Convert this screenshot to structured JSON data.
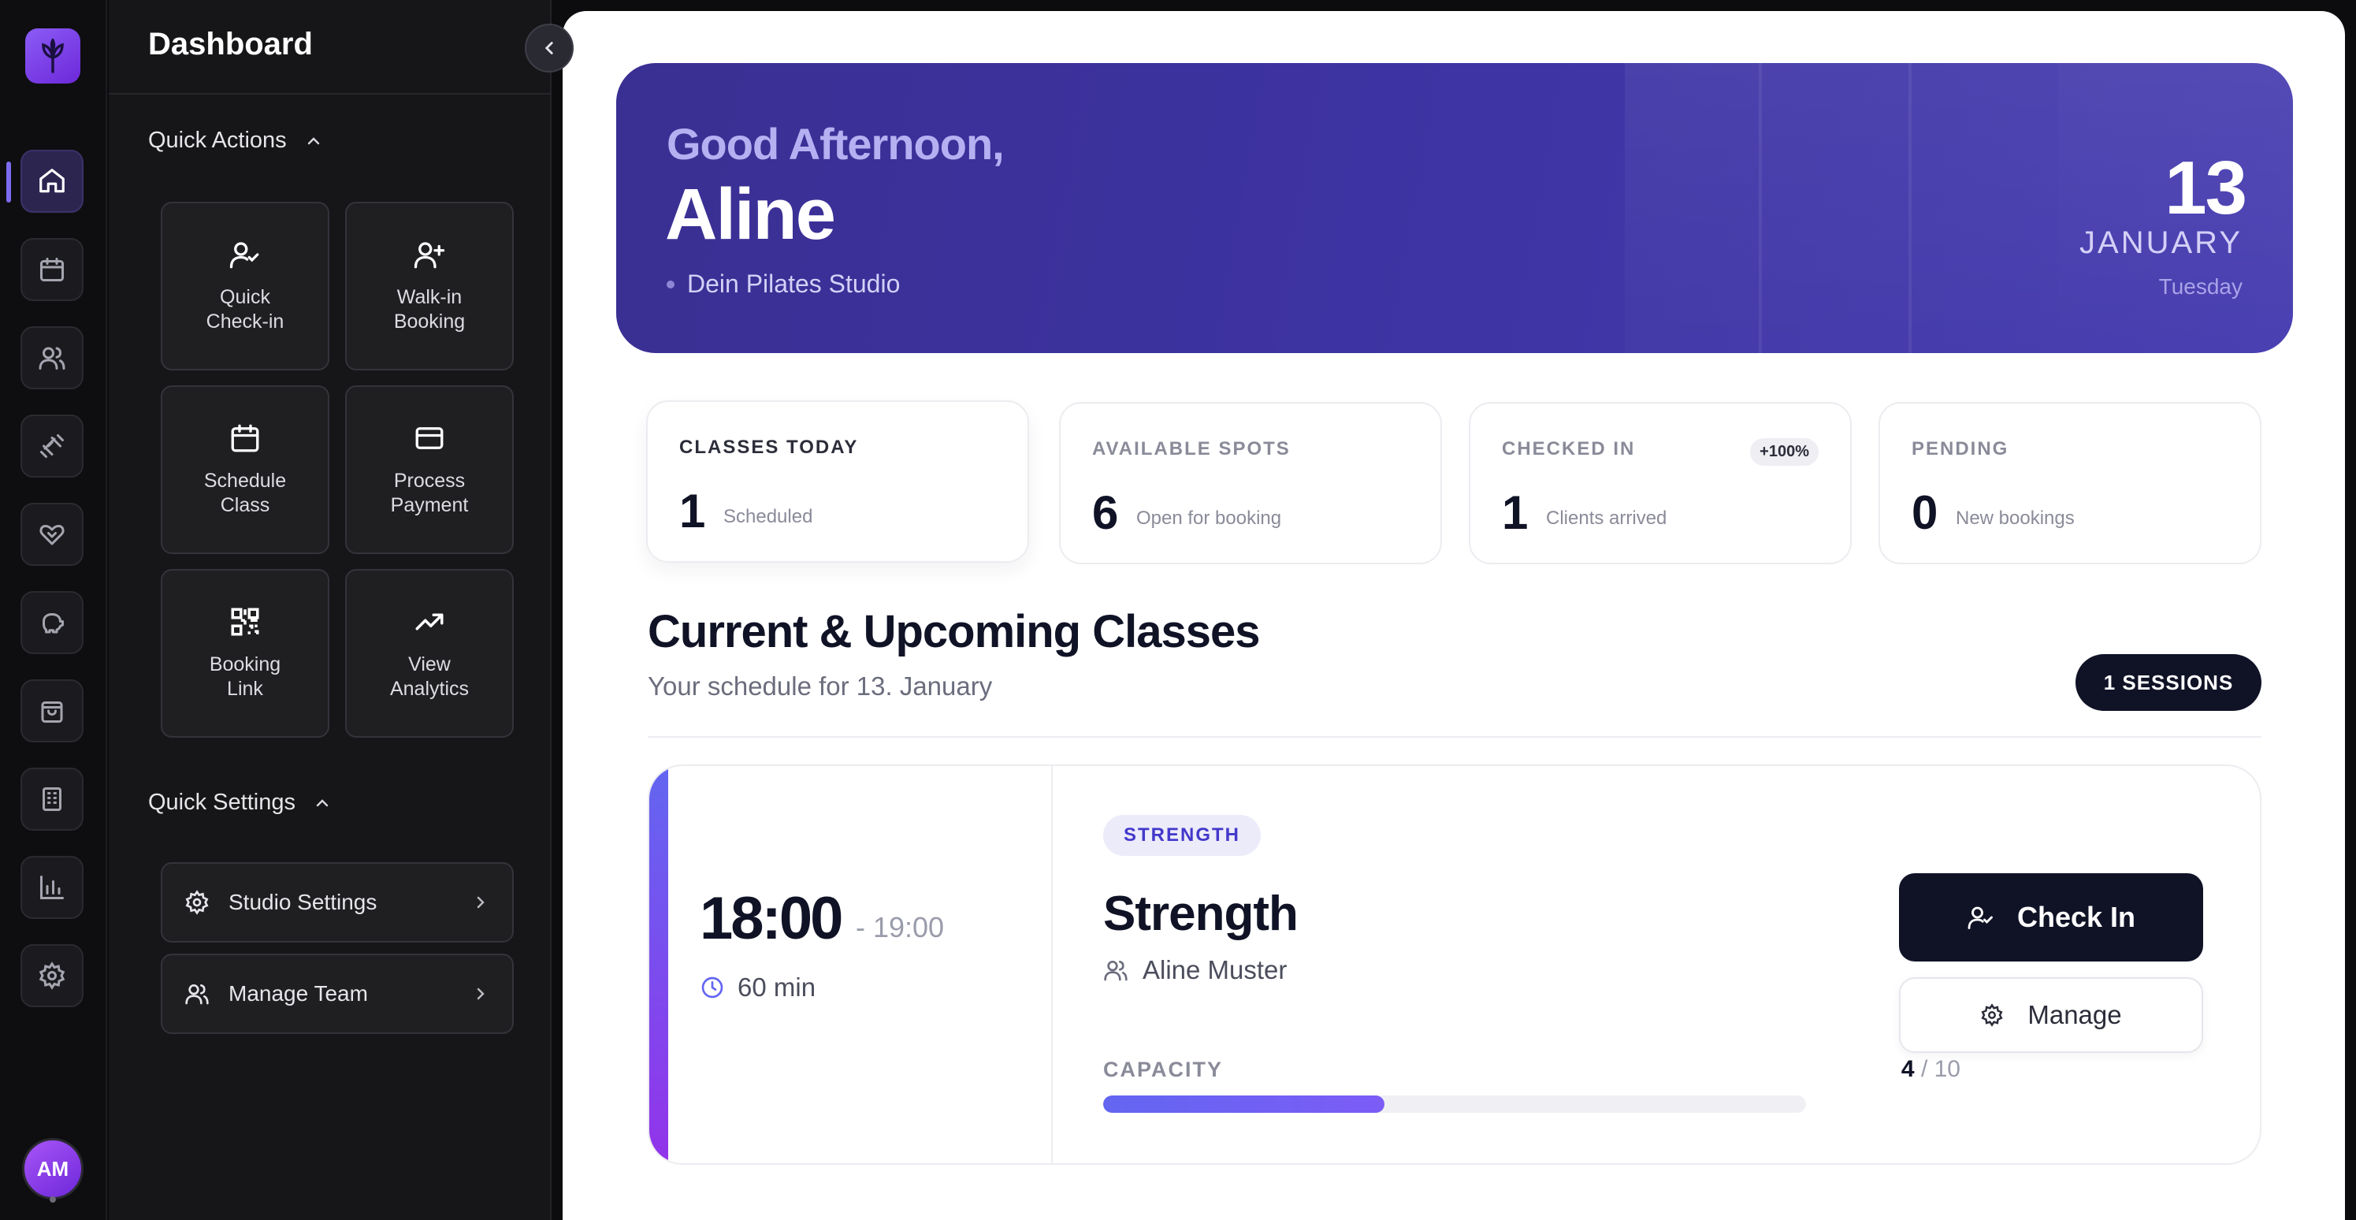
{
  "sidebar": {
    "title": "Dashboard",
    "quick_actions": {
      "label": "Quick Actions",
      "items": [
        {
          "label": "Quick\nCheck-in",
          "icon": "user-check-icon"
        },
        {
          "label": "Walk-in\nBooking",
          "icon": "user-plus-icon"
        },
        {
          "label": "Schedule\nClass",
          "icon": "calendar-icon"
        },
        {
          "label": "Process\nPayment",
          "icon": "credit-card-icon"
        },
        {
          "label": "Booking\nLink",
          "icon": "qr-code-icon"
        },
        {
          "label": "View\nAnalytics",
          "icon": "trending-up-icon"
        }
      ]
    },
    "quick_settings": {
      "label": "Quick Settings",
      "items": [
        {
          "label": "Studio Settings",
          "icon": "gear-icon"
        },
        {
          "label": "Manage Team",
          "icon": "users-icon"
        }
      ]
    }
  },
  "rail": {
    "icons": [
      "home-icon",
      "calendar-icon",
      "users-icon",
      "dumbbell-icon",
      "heart-handshake-icon",
      "piggy-bank-icon",
      "shopping-bag-icon",
      "building-icon",
      "bar-chart-icon",
      "gear-icon"
    ],
    "avatar_initials": "AM"
  },
  "hero": {
    "greeting": "Good Afternoon,",
    "name": "Aline",
    "studio": "Dein Pilates Studio",
    "day": "13",
    "month": "JANUARY",
    "weekday": "Tuesday"
  },
  "stats": [
    {
      "label": "CLASSES TODAY",
      "value": "1",
      "sub": "Scheduled"
    },
    {
      "label": "AVAILABLE SPOTS",
      "value": "6",
      "sub": "Open for booking"
    },
    {
      "label": "CHECKED IN",
      "value": "1",
      "sub": "Clients arrived",
      "badge": "+100%"
    },
    {
      "label": "PENDING",
      "value": "0",
      "sub": "New bookings"
    }
  ],
  "classes": {
    "title": "Current & Upcoming Classes",
    "subtitle": "Your schedule for 13. January",
    "count_label": "1 SESSIONS",
    "items": [
      {
        "start": "18:00",
        "end": "- 19:00",
        "duration": "60 min",
        "tag": "STRENGTH",
        "name": "Strength",
        "instructor": "Aline Muster",
        "capacity_label": "CAPACITY",
        "booked": "4",
        "capacity": "/ 10",
        "fill_fraction": 0.4,
        "checkin_label": "Check In",
        "manage_label": "Manage"
      }
    ]
  },
  "colors": {
    "accent": "#6366f1",
    "hero": "#3d33a2",
    "dark": "#101326"
  }
}
